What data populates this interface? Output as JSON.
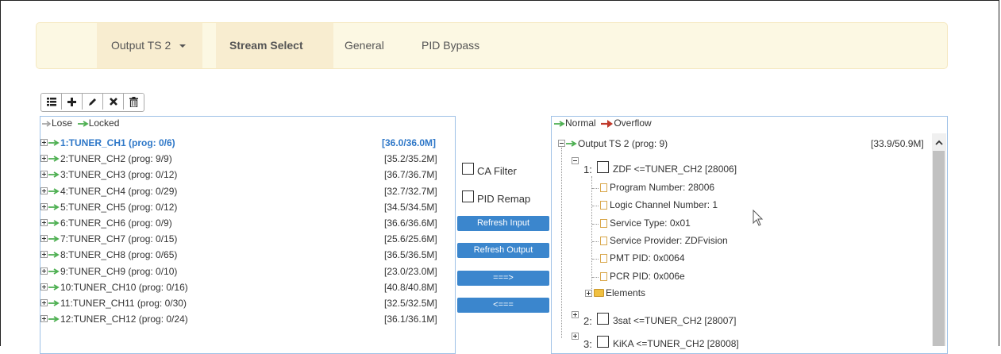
{
  "nav": {
    "output_ts": "Output TS 2",
    "stream_select": "Stream Select",
    "general": "General",
    "pid_bypass": "PID Bypass"
  },
  "toolbar": {
    "icons": [
      "list-icon",
      "plus-icon",
      "pencil-icon",
      "close-icon",
      "trash-icon"
    ]
  },
  "input_panel": {
    "legend_lose": "Lose",
    "legend_locked": "Locked",
    "items": [
      {
        "label": "1:TUNER_CH1 (prog: 0/6)",
        "rate": "[36.0/36.0M]"
      },
      {
        "label": "2:TUNER_CH2 (prog: 9/9)",
        "rate": "[35.2/35.2M]"
      },
      {
        "label": "3:TUNER_CH3 (prog: 0/12)",
        "rate": "[36.7/36.7M]"
      },
      {
        "label": "4:TUNER_CH4 (prog: 0/29)",
        "rate": "[32.7/32.7M]"
      },
      {
        "label": "5:TUNER_CH5 (prog: 0/12)",
        "rate": "[34.5/34.5M]"
      },
      {
        "label": "6:TUNER_CH6 (prog: 0/9)",
        "rate": "[36.6/36.6M]"
      },
      {
        "label": "7:TUNER_CH7 (prog: 0/15)",
        "rate": "[25.6/25.6M]"
      },
      {
        "label": "8:TUNER_CH8 (prog: 0/65)",
        "rate": "[36.5/36.5M]"
      },
      {
        "label": "9:TUNER_CH9 (prog: 0/10)",
        "rate": "[23.0/23.0M]"
      },
      {
        "label": "10:TUNER_CH10 (prog: 0/16)",
        "rate": "[40.8/40.8M]"
      },
      {
        "label": "11:TUNER_CH11 (prog: 0/30)",
        "rate": "[32.5/32.5M]"
      },
      {
        "label": "12:TUNER_CH12 (prog: 0/24)",
        "rate": "[36.1/36.1M]"
      }
    ]
  },
  "controls": {
    "ca_filter": "CA Filter",
    "pid_remap": "PID Remap",
    "refresh_input": "Refresh Input",
    "refresh_output": "Refresh Output",
    "move_right": "===>",
    "move_left": "<==="
  },
  "output_panel": {
    "legend_normal": "Normal",
    "legend_overflow": "Overflow",
    "root_label": "Output TS 2 (prog: 9)",
    "root_rate": "[33.9/50.9M]",
    "programs": [
      {
        "num": "1:",
        "label": "ZDF <=TUNER_CH2 [28006]"
      },
      {
        "num": "2:",
        "label": "3sat <=TUNER_CH2 [28007]"
      },
      {
        "num": "3:",
        "label": "KiKA <=TUNER_CH2 [28008]"
      }
    ],
    "details": [
      "Program Number: 28006",
      "Logic Channel Number: 1",
      "Service Type: 0x01",
      "Service Provider: ZDFvision",
      "PMT PID: 0x0064",
      "PCR PID: 0x006e"
    ],
    "elements": "Elements"
  },
  "colors": {
    "green_arrow": "#4caf50",
    "red_arrow": "#c0392b",
    "button_blue": "#3b86cd",
    "selected_text": "#2f78c8"
  }
}
